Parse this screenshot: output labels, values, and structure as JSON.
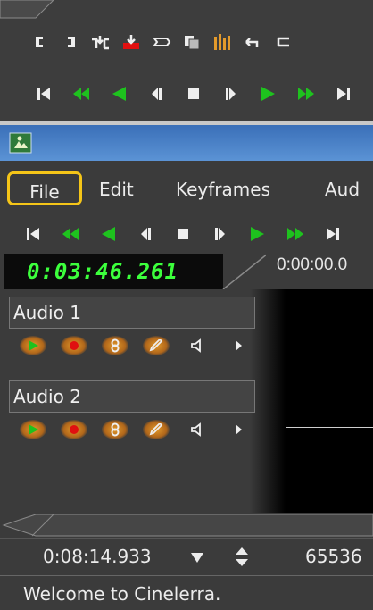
{
  "viewer": {
    "edit_toolbar_icons": [
      "in-point-icon",
      "out-point-icon",
      "splice-icon",
      "overwrite-icon",
      "to-clip-icon",
      "copy-icon",
      "meters-icon",
      "undo-icon",
      "redo-icon"
    ],
    "transport_icons": [
      "rewind-icon",
      "fast-reverse-icon",
      "reverse-play-icon",
      "frame-back-icon",
      "stop-icon",
      "frame-forward-icon",
      "play-icon",
      "fast-forward-icon",
      "jump-end-icon"
    ]
  },
  "menubar": {
    "file": "File",
    "edit": "Edit",
    "keyframes": "Keyframes",
    "audio": "Aud"
  },
  "clock": {
    "time": "0:03:46.261"
  },
  "ruler": {
    "start_time": "0:00:00.0"
  },
  "tracks": [
    {
      "name": "Audio 1"
    },
    {
      "name": "Audio 2"
    }
  ],
  "status": {
    "selection_length": "0:08:14.933",
    "sample_rate": "65536",
    "message": "Welcome to Cinelerra."
  },
  "colors": {
    "accent_green": "#1ec21e",
    "record_red": "#e01010",
    "highlight_yellow": "#f5c518",
    "titlebar_blue": "#4a80c8"
  }
}
